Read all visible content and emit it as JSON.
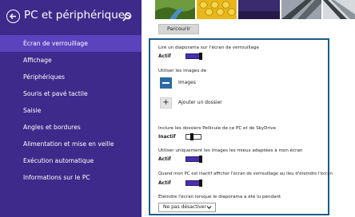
{
  "sidebar": {
    "title": "PC et périphériques",
    "back_icon": "back-arrow-icon",
    "search_icon": "search-icon",
    "items": [
      {
        "label": "Écran de verrouillage",
        "active": true
      },
      {
        "label": "Affichage",
        "active": false
      },
      {
        "label": "Périphériques",
        "active": false
      },
      {
        "label": "Souris et pavé tactile",
        "active": false
      },
      {
        "label": "Saisie",
        "active": false
      },
      {
        "label": "Angles et bordures",
        "active": false
      },
      {
        "label": "Alimentation et mise en veille",
        "active": false
      },
      {
        "label": "Exécution automatique",
        "active": false
      },
      {
        "label": "Informations sur le PC",
        "active": false
      }
    ],
    "bg_color": "#3d2a8a",
    "active_color": "#5b43bd"
  },
  "main": {
    "browse_label": "Parcourir",
    "slideshow": {
      "label": "Lire un diaporama sur l'écran de verrouillage",
      "state": "Actif"
    },
    "use_images": {
      "label": "Utiliser les images de"
    },
    "folders": [
      {
        "label": "Images",
        "icon": "folder-bar-icon"
      },
      {
        "label": "Ajouter un dossier",
        "icon": "plus-icon"
      }
    ],
    "include_camera": {
      "label": "Inclure les dossiers Pellicule de ce PC et de SkyDrive",
      "state": "Inactif"
    },
    "best_fit": {
      "label": "Utiliser uniquement les images les mieux adaptées à mon écran",
      "state": "Actif"
    },
    "inactive_pc": {
      "label": "Quand mon PC est inactif afficher l'écran de verrouillage au lieu d'éteindre l'écran",
      "state": "Actif"
    },
    "turn_off": {
      "label": "Éteindre l'écran lorsque le diaporama a été lu pendant",
      "value": "Ne pas désactiver"
    },
    "accent_color": "#4a2fb3",
    "panel_border_color": "#1a5d8c"
  }
}
